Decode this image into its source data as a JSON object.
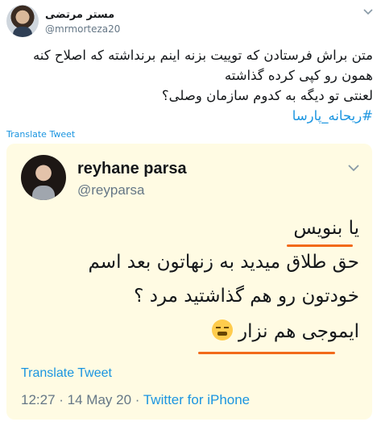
{
  "tweet": {
    "author_name": "مستر مرتضی",
    "author_handle": "@mrmorteza20",
    "text_lines": [
      "متن براش فرستادن که توییت بزنه اینم برنداشته که اصلاح کنه",
      "همون رو کپی کرده گذاشته",
      "لعنتی تو دیگه به کدوم سازمان وصلی؟"
    ],
    "hashtag": "#ریحانه_پارسا",
    "translate_label": "Translate Tweet"
  },
  "embedded": {
    "author_name": "reyhane parsa",
    "author_handle": "@reyparsa",
    "lines": [
      "یا بنویس",
      "حق طلاق میدید به زنهاتون بعد اسم",
      "خودتون رو هم گذاشتید مرد ؟",
      "ایموجی هم نزار"
    ],
    "emoji": "tired-face-emoji",
    "translate_label": "Translate Tweet",
    "time": "12:27",
    "separator": " · ",
    "date": "14 May 20",
    "source": "Twitter for iPhone",
    "underline_color": "#f26a1b",
    "background_color": "#fffbe3"
  }
}
